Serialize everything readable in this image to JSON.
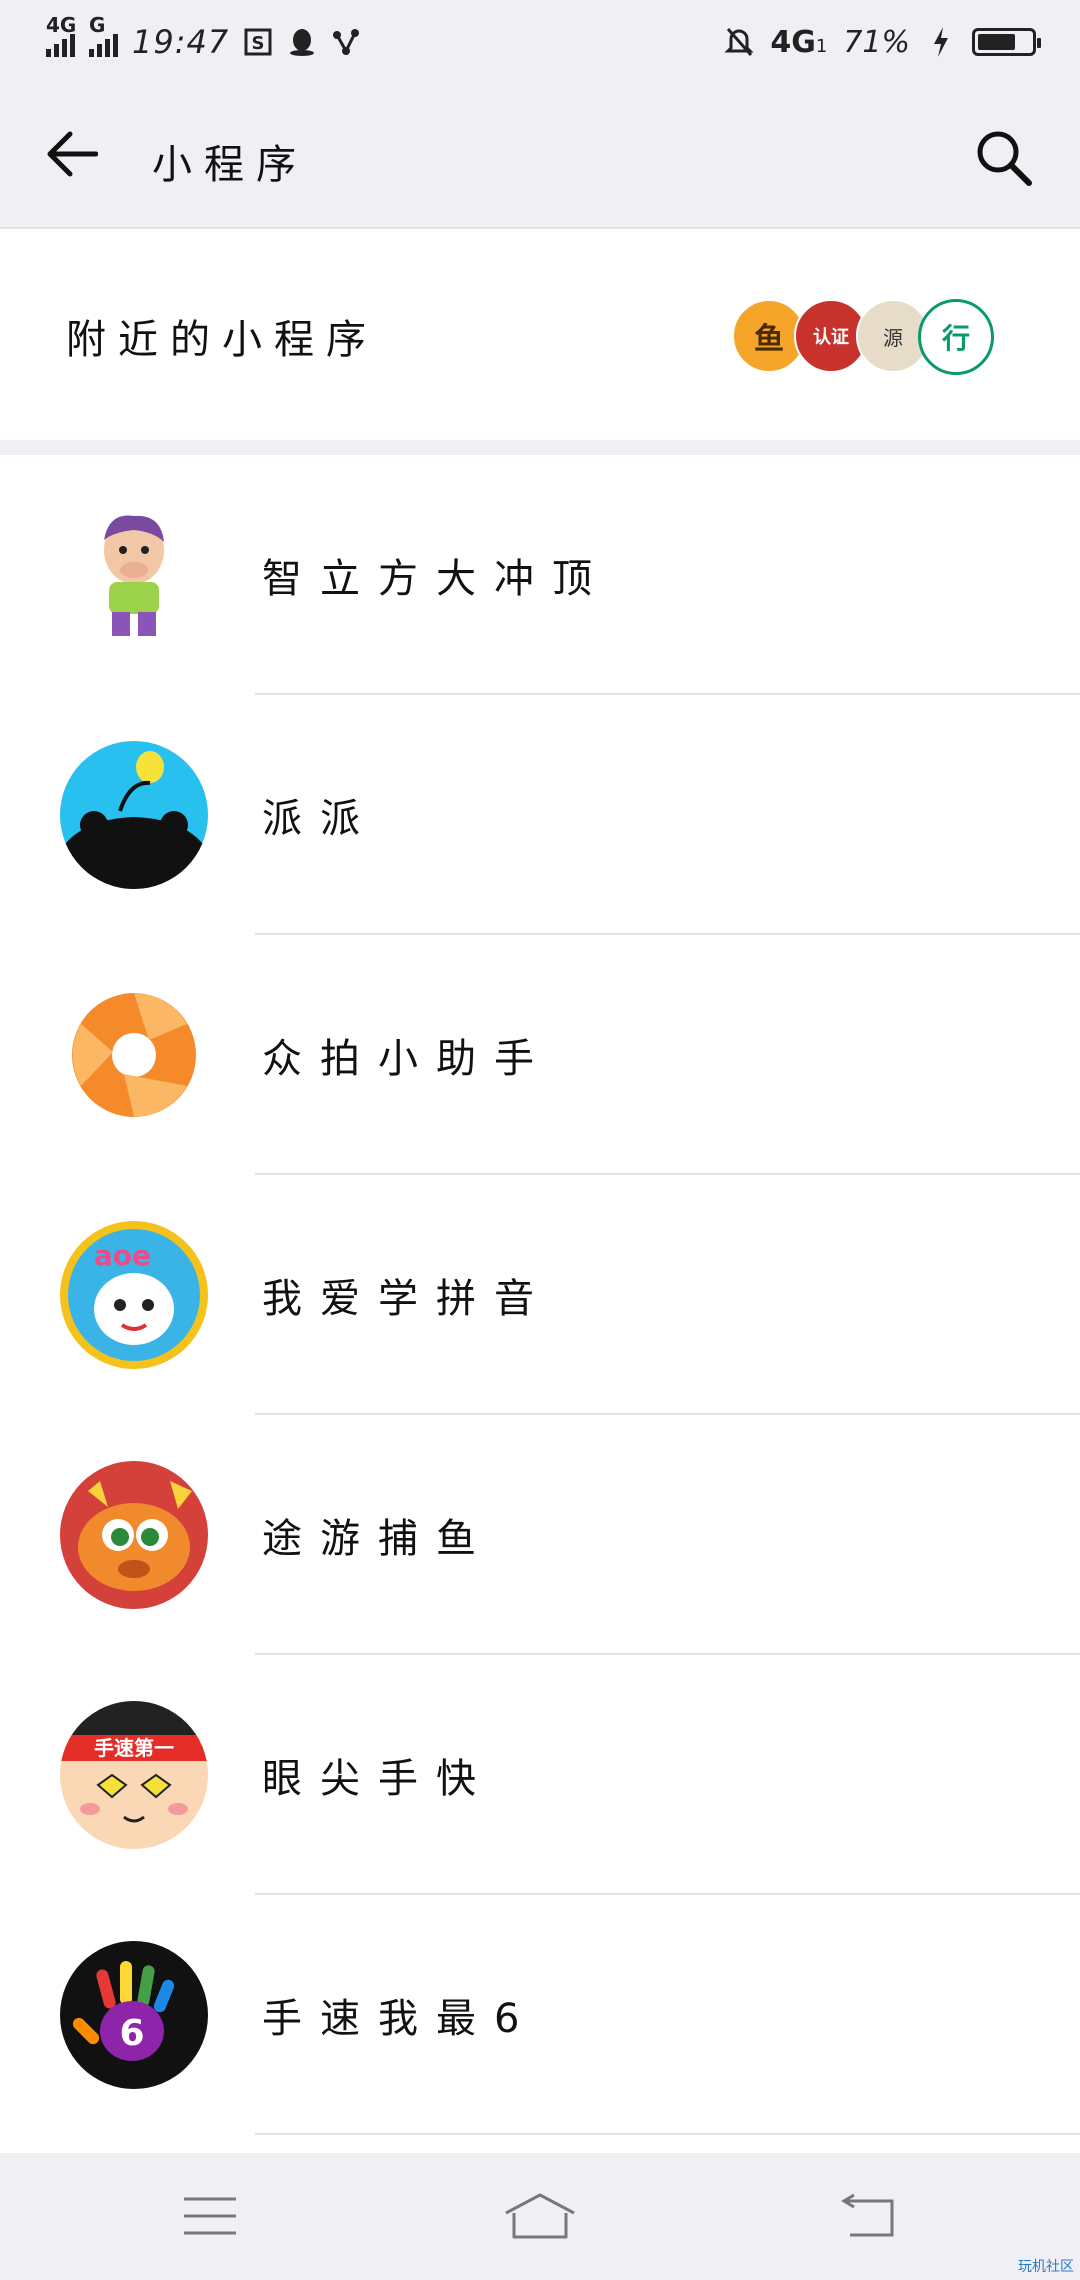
{
  "status_bar": {
    "network_1": "4G",
    "network_2": "G",
    "time": "19:47",
    "network_right": "4G",
    "network_right_sub": "1",
    "battery_percent": "71%",
    "battery_level": 0.71
  },
  "app_bar": {
    "title": "小程序",
    "back_icon": "arrow-left-icon",
    "search_icon": "search-icon"
  },
  "nearby": {
    "title": "附近的小程序",
    "logos": [
      "鱼",
      "认证",
      "源",
      "行"
    ]
  },
  "mini_programs": [
    {
      "name": "智立方大冲顶",
      "icon": "cartoon-character-icon"
    },
    {
      "name": "派派",
      "icon": "paipai-icon"
    },
    {
      "name": "众拍小助手",
      "icon": "aperture-icon"
    },
    {
      "name": "我爱学拼音",
      "icon": "pinyin-icon"
    },
    {
      "name": "途游捕鱼",
      "icon": "fish-game-icon"
    },
    {
      "name": "眼尖手快",
      "icon": "face-game-icon"
    },
    {
      "name": "手速我最6",
      "icon": "rainbow-hand-icon"
    }
  ],
  "avatar_texts": {
    "pinyin_letters": "aoe",
    "headband": "手速第一",
    "hand_number": "6"
  },
  "nav": {
    "menu_icon": "menu-icon",
    "home_icon": "home-icon",
    "back_icon": "back-icon"
  },
  "watermark": "玩机社区",
  "colors": {
    "background": "#f0f0f4",
    "panel": "#ffffff",
    "divider": "#e3e3e3"
  }
}
